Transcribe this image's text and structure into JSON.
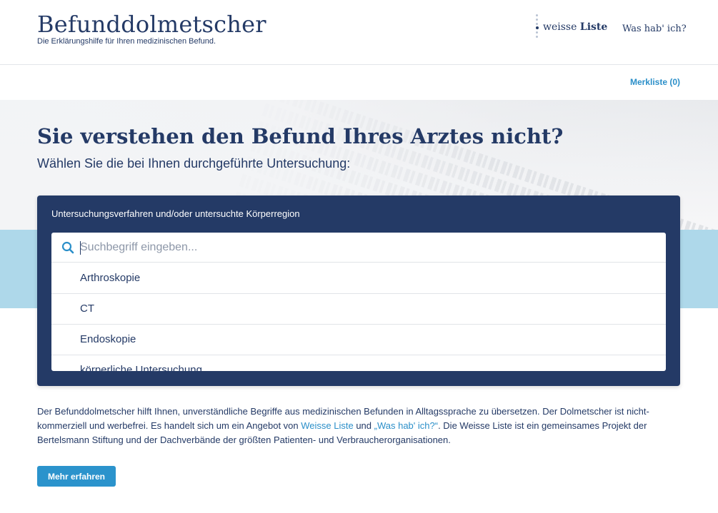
{
  "header": {
    "title": "Befunddolmetscher",
    "subtitle": "Die Erklärungshilfe für Ihren medizinischen Befund.",
    "logo_weisse": "weisse",
    "logo_liste": "Liste",
    "logo_whi": "Was hab' ich?"
  },
  "subnav": {
    "merkliste_label": "Merkliste (0)"
  },
  "hero": {
    "title": "Sie verstehen den Befund Ihres Arztes nicht?",
    "subtitle": "Wählen Sie die bei Ihnen durchgeführte Untersuchung:"
  },
  "search": {
    "label": "Untersuchungsverfahren und/oder untersuchte Körperregion",
    "placeholder": "Suchbegriff eingeben...",
    "value": "",
    "options": [
      "Arthroskopie",
      "CT",
      "Endoskopie",
      "körperliche Untersuchung"
    ]
  },
  "about": {
    "text1": "Der Befunddolmetscher hilft Ihnen, unverständliche Begriffe aus medizinischen Befunden in Alltagssprache zu übersetzen. Der Dolmetscher ist nicht-kommerziell und werbefrei. Es handelt sich um ein Angebot von ",
    "link1": "Weisse Liste",
    "text2": " und ",
    "link2": "„Was hab' ich?“",
    "text3": ". Die Weisse Liste ist ein gemeinsames Projekt der Bertelsmann Stiftung und der Dachverbände der größten Patienten- und Verbraucherorganisationen.",
    "button_label": "Mehr erfahren"
  },
  "colors": {
    "navy": "#243a66",
    "accent": "#2b93cc",
    "band": "#aed8ea"
  },
  "icons": {
    "search": "search-icon"
  }
}
